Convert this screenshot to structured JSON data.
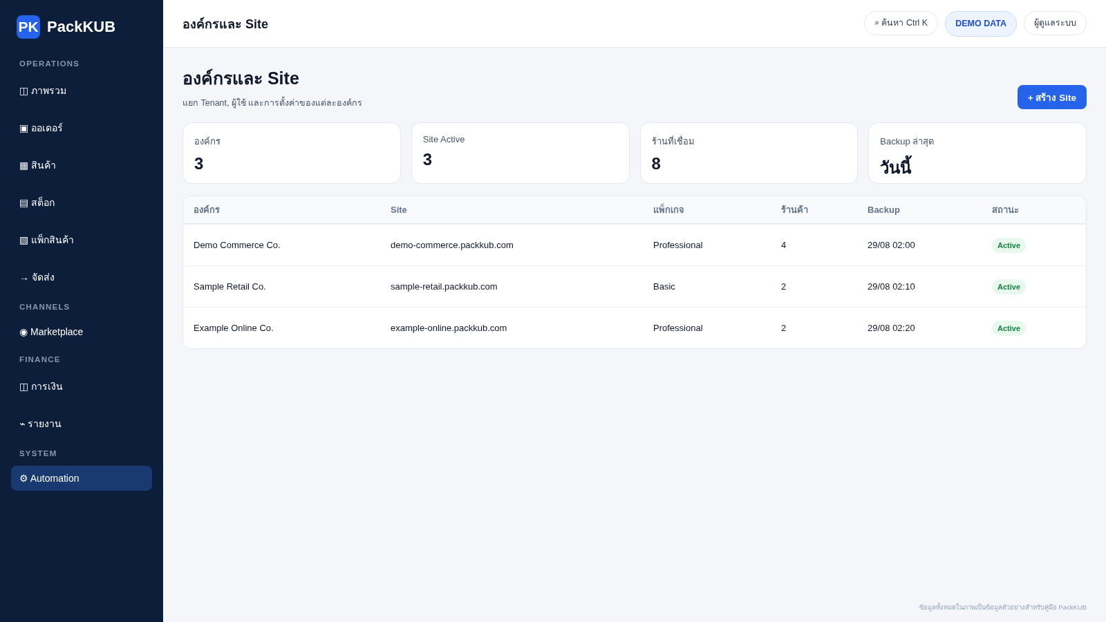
{
  "brand": {
    "logo": "PK",
    "name": "PackKUB"
  },
  "sidebar": {
    "sections": [
      {
        "title": "OPERATIONS",
        "items": [
          {
            "icon": "◫",
            "label": "ภาพรวม",
            "selected": false
          },
          {
            "icon": "▣",
            "label": "ออเดอร์",
            "selected": false
          },
          {
            "icon": "▦",
            "label": "สินค้า",
            "selected": false
          },
          {
            "icon": "▤",
            "label": "สต็อก",
            "selected": false
          },
          {
            "icon": "▧",
            "label": "แพ็กสินค้า",
            "selected": false
          },
          {
            "icon": "→",
            "label": "จัดส่ง",
            "selected": false
          }
        ]
      },
      {
        "title": "CHANNELS",
        "items": [
          {
            "icon": "◉",
            "label": "Marketplace",
            "selected": false
          }
        ]
      },
      {
        "title": "FINANCE",
        "items": [
          {
            "icon": "◫",
            "label": "การเงิน",
            "selected": false
          },
          {
            "icon": "⌁",
            "label": "รายงาน",
            "selected": false
          }
        ]
      },
      {
        "title": "SYSTEM",
        "items": [
          {
            "icon": "⚙",
            "label": "Automation",
            "selected": true
          }
        ]
      }
    ]
  },
  "topbar": {
    "title": "องค์กรและ Site",
    "search": "⌕ ค้นหา Ctrl K",
    "demo_badge": "DEMO DATA",
    "user": "ผู้ดูแลระบบ"
  },
  "page": {
    "title": "องค์กรและ Site",
    "subtitle": "แยก Tenant, ผู้ใช้ และการตั้งค่าของแต่ละองค์กร",
    "create_button": "+ สร้าง Site"
  },
  "stats": [
    {
      "label": "องค์กร",
      "value": "3"
    },
    {
      "label": "Site Active",
      "value": "3"
    },
    {
      "label": "ร้านที่เชื่อม",
      "value": "8"
    },
    {
      "label": "Backup ล่าสุด",
      "value": "วันนี้"
    }
  ],
  "table": {
    "columns": [
      "องค์กร",
      "Site",
      "แพ็กเกจ",
      "ร้านค้า",
      "Backup",
      "สถานะ"
    ],
    "rows": [
      {
        "org": "Demo Commerce Co.",
        "site": "demo-commerce.packkub.com",
        "package": "Professional",
        "stores": "4",
        "backup": "29/08 02:00",
        "status": "Active"
      },
      {
        "org": "Sample Retail Co.",
        "site": "sample-retail.packkub.com",
        "package": "Basic",
        "stores": "2",
        "backup": "29/08 02:10",
        "status": "Active"
      },
      {
        "org": "Example Online Co.",
        "site": "example-online.packkub.com",
        "package": "Professional",
        "stores": "2",
        "backup": "29/08 02:20",
        "status": "Active"
      }
    ]
  },
  "footer": "ข้อมูลทั้งหมดในภาพเป็นข้อมูลตัวอย่างสำหรับคู่มือ PackKUB"
}
